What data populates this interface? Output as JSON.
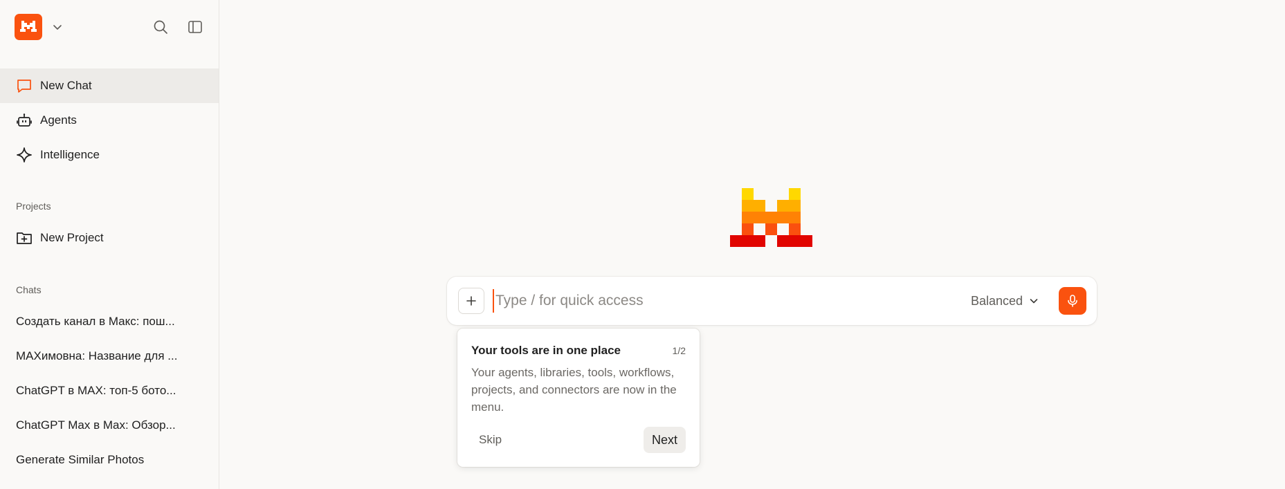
{
  "sidebar": {
    "logo_icon": "mistral-m-logo",
    "nav": [
      {
        "label": "New Chat",
        "icon": "chat-bubble-icon",
        "active": true
      },
      {
        "label": "Agents",
        "icon": "robot-icon"
      },
      {
        "label": "Intelligence",
        "icon": "sparkle-icon"
      }
    ],
    "projects_label": "Projects",
    "new_project_label": "New Project",
    "chats_label": "Chats",
    "chats": [
      "Создать канал в Макс: пош...",
      "MAXимовна: Название для ...",
      "ChatGPT в MAX: топ-5 бото...",
      "ChatGPT Max в Max: Обзор...",
      "Generate Similar Photos"
    ]
  },
  "composer": {
    "placeholder": "Type / for quick access",
    "mode_label": "Balanced"
  },
  "tour": {
    "title": "Your tools are in one place",
    "step": "1/2",
    "body": "Your agents, libraries, tools, workflows, projects, and connectors are now in the menu.",
    "skip_label": "Skip",
    "next_label": "Next"
  },
  "colors": {
    "accent": "#fa520f",
    "background": "#faf9f7",
    "active_nav": "#edebe8"
  }
}
